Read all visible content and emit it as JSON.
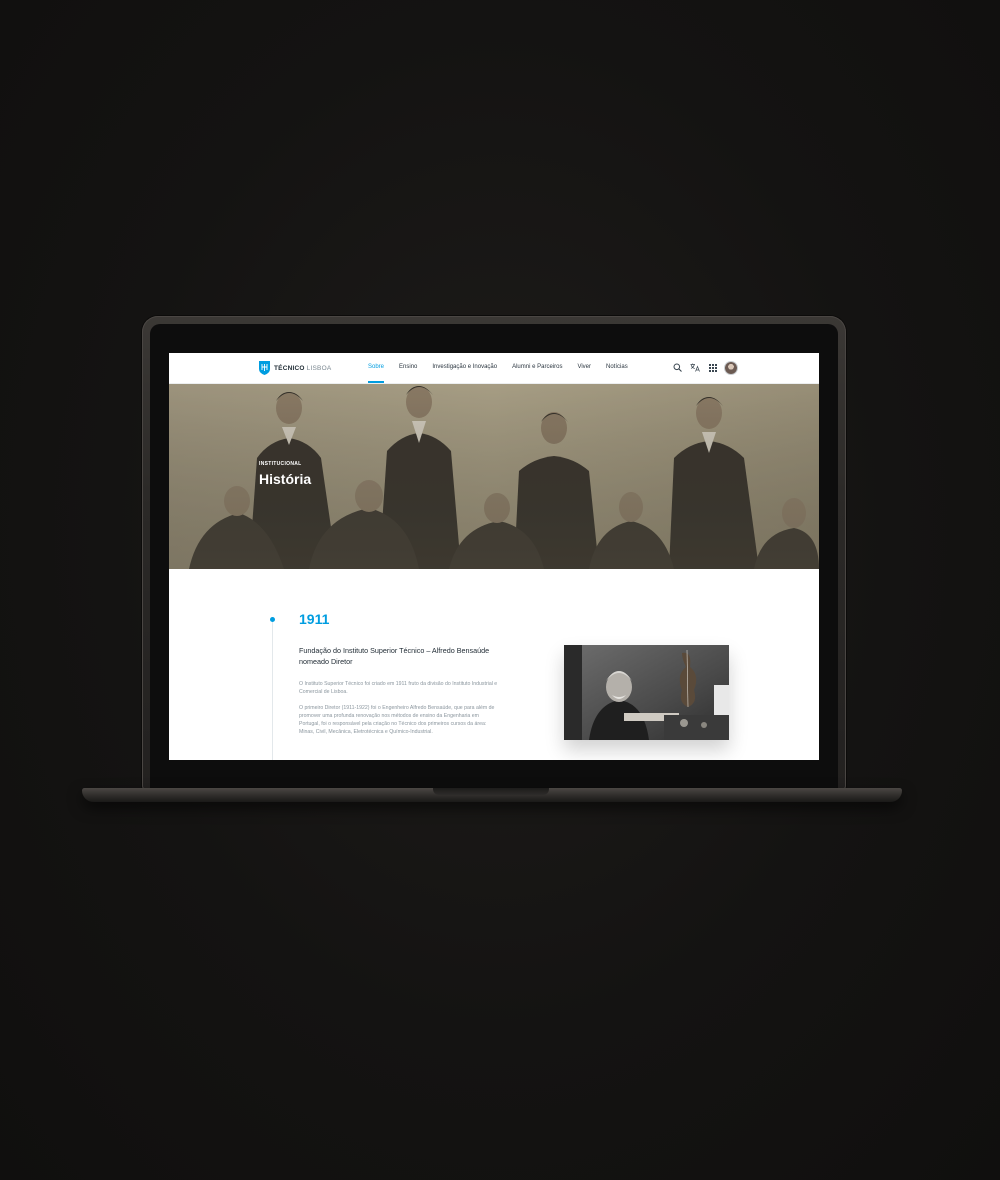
{
  "nav": {
    "logo": {
      "brand_bold": "TÉCNICO",
      "brand_light": "LISBOA"
    },
    "menu": [
      {
        "label": "Sobre",
        "active": true
      },
      {
        "label": "Ensino",
        "active": false
      },
      {
        "label": "Investigação e Inovação",
        "active": false
      },
      {
        "label": "Alumni e Parceiros",
        "active": false
      },
      {
        "label": "Viver",
        "active": false
      },
      {
        "label": "Notícias",
        "active": false
      }
    ],
    "tools": [
      "search-icon",
      "translate-icon",
      "apps-grid-icon",
      "user-avatar"
    ]
  },
  "hero": {
    "label": "INSTITUCIONAL",
    "title": "História"
  },
  "timeline": {
    "year": "1911",
    "headline": "Fundação do Instituto Superior Técnico – Alfredo Bensaúde nomeado Diretor",
    "paragraphs": [
      "O Instituto Superior Técnico foi criado em 1911 fruto da divisão do Instituto Industrial e Comercial de Lisboa.",
      "O primeiro Diretor (1911-1922) foi o Engenheiro Alfredo Bensaúde, que para além de promover uma profunda renovação nos métodos de ensino da Engenharia em Portugal, foi o responsável pela criação no Técnico dos primeiros cursos da área: Minas, Civil, Mecânica, Eletrotécnica e Químico-Industrial."
    ]
  },
  "colors": {
    "accent": "#009de0",
    "hero_tint": "#8c8470",
    "background": "#141312"
  }
}
